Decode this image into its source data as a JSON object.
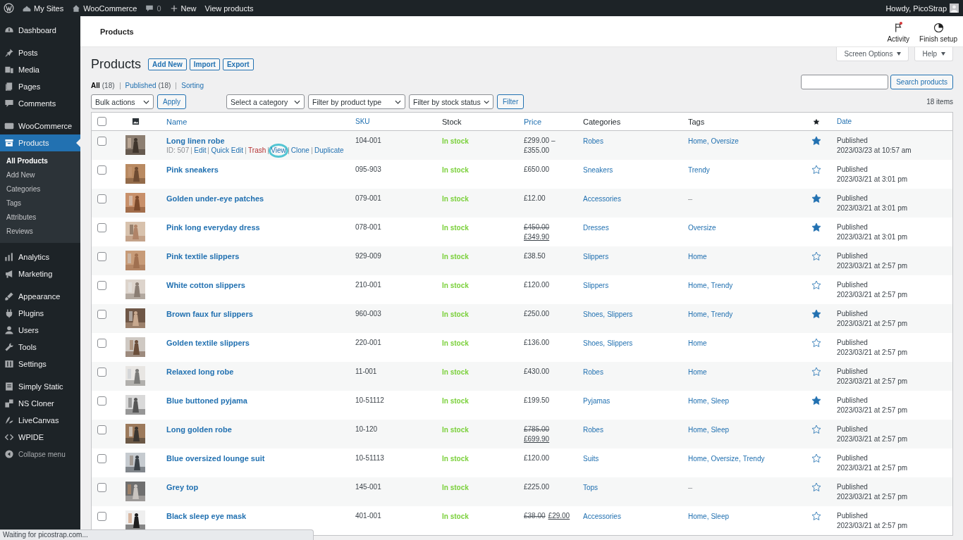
{
  "admin_bar": {
    "items": [
      {
        "label": "My Sites"
      },
      {
        "label": "WooCommerce"
      },
      {
        "label": "0"
      },
      {
        "label": "New"
      },
      {
        "label": "View products"
      }
    ],
    "account": "Howdy, PicoStrap"
  },
  "sidebar": {
    "groups": [
      [
        {
          "label": "Dashboard",
          "selected": false
        }
      ],
      [
        {
          "label": "Posts",
          "selected": false
        },
        {
          "label": "Media",
          "selected": false
        },
        {
          "label": "Pages",
          "selected": false
        },
        {
          "label": "Comments",
          "selected": false
        }
      ],
      [
        {
          "label": "WooCommerce",
          "selected": false
        },
        {
          "label": "Products",
          "selected": true,
          "children": [
            {
              "label": "All Products",
              "selected": true
            },
            {
              "label": "Add New",
              "selected": false
            },
            {
              "label": "Categories",
              "selected": false
            },
            {
              "label": "Tags",
              "selected": false
            },
            {
              "label": "Attributes",
              "selected": false
            },
            {
              "label": "Reviews",
              "selected": false
            }
          ]
        }
      ],
      [
        {
          "label": "Analytics",
          "selected": false
        },
        {
          "label": "Marketing",
          "selected": false
        }
      ],
      [
        {
          "label": "Appearance",
          "selected": false
        },
        {
          "label": "Plugins",
          "selected": false
        },
        {
          "label": "Users",
          "selected": false
        },
        {
          "label": "Tools",
          "selected": false
        },
        {
          "label": "Settings",
          "selected": false
        }
      ],
      [
        {
          "label": "Simply Static",
          "selected": false
        },
        {
          "label": "NS Cloner",
          "selected": false
        },
        {
          "label": "LiveCanvas",
          "selected": false
        },
        {
          "label": "WPIDE",
          "selected": false
        },
        {
          "label": "Collapse menu",
          "selected": false
        }
      ]
    ]
  },
  "header": {
    "title": "Products",
    "actions": [
      {
        "label": "Activity",
        "notification": true
      },
      {
        "label": "Finish setup",
        "notification": false
      }
    ]
  },
  "screen_tabs": [
    "Screen Options",
    "Help"
  ],
  "page": {
    "title": "Products",
    "buttons": [
      "Add New",
      "Import",
      "Export"
    ]
  },
  "views": [
    {
      "label": "All",
      "count": "(18)",
      "selected": true
    },
    {
      "label": "Published",
      "count": "(18)",
      "selected": false
    },
    {
      "label": "Sorting",
      "selected": false
    }
  ],
  "search": {
    "button": "Search products"
  },
  "filters": {
    "bulk": "Bulk actions",
    "apply": "Apply",
    "selects": [
      "Select a category",
      "Filter by product type",
      "Filter by stock status"
    ],
    "filter": "Filter",
    "count": "18 items"
  },
  "table": {
    "columns": [
      {
        "label": "Name",
        "sortable": true
      },
      {
        "label": "SKU",
        "sortable": true
      },
      {
        "label": "Stock",
        "sortable": false
      },
      {
        "label": "Price",
        "sortable": true
      },
      {
        "label": "Categories",
        "sortable": false
      },
      {
        "label": "Tags",
        "sortable": false
      },
      {
        "label": "Date",
        "sortable": true
      }
    ],
    "select_all": {
      "checked": false
    },
    "rows": [
      {
        "checked": false,
        "name": "Long linen robe",
        "actions": [
          {
            "label": "ID: 507",
            "kind": "id",
            "highlighted": false
          },
          {
            "label": "Edit",
            "kind": "link",
            "highlighted": false
          },
          {
            "label": "Quick Edit",
            "kind": "link",
            "highlighted": false
          },
          {
            "label": "Trash",
            "kind": "trash",
            "highlighted": false
          },
          {
            "label": "View",
            "kind": "link",
            "highlighted": true
          },
          {
            "label": "Clone",
            "kind": "link",
            "highlighted": false
          },
          {
            "label": "Duplicate",
            "kind": "link",
            "highlighted": false
          }
        ],
        "sku": "104-001",
        "stock": "In stock",
        "price": [
          [
            {
              "text": "£299.00 –",
              "kind": "plain"
            }
          ],
          [
            {
              "text": "£355.00",
              "kind": "plain"
            }
          ]
        ],
        "categories": [
          "Robes"
        ],
        "tags": [
          "Home,",
          "Oversize"
        ],
        "featured": true,
        "status": "Published",
        "date": "2023/03/23 at 10:57 am"
      },
      {
        "checked": false,
        "name": "Pink sneakers",
        "sku": "095-903",
        "stock": "In stock",
        "price": [
          [
            {
              "text": "£650.00",
              "kind": "plain"
            }
          ]
        ],
        "categories": [
          "Sneakers"
        ],
        "tags": [
          "Trendy"
        ],
        "featured": false,
        "status": "Published",
        "date": "2023/03/21 at 3:01 pm"
      },
      {
        "checked": false,
        "name": "Golden under-eye patches",
        "sku": "079-001",
        "stock": "In stock",
        "price": [
          [
            {
              "text": "£12.00",
              "kind": "plain"
            }
          ]
        ],
        "categories": [
          "Accessories"
        ],
        "tags": [],
        "no_tags": "–",
        "featured": true,
        "status": "Published",
        "date": "2023/03/21 at 3:01 pm"
      },
      {
        "checked": false,
        "name": "Pink long everyday dress",
        "sku": "078-001",
        "stock": "In stock",
        "price": [
          [
            {
              "text": "£450.00",
              "kind": "old"
            }
          ],
          [
            {
              "text": "£349.90",
              "kind": "sale"
            }
          ]
        ],
        "categories": [
          "Dresses"
        ],
        "tags": [
          "Oversize"
        ],
        "featured": true,
        "status": "Published",
        "date": "2023/03/21 at 3:01 pm"
      },
      {
        "checked": false,
        "name": "Pink textile slippers",
        "sku": "929-009",
        "stock": "In stock",
        "price": [
          [
            {
              "text": "£38.50",
              "kind": "plain"
            }
          ]
        ],
        "categories": [
          "Slippers"
        ],
        "tags": [
          "Home"
        ],
        "featured": false,
        "status": "Published",
        "date": "2023/03/21 at 2:57 pm"
      },
      {
        "checked": false,
        "name": "White cotton slippers",
        "sku": "210-001",
        "stock": "In stock",
        "price": [
          [
            {
              "text": "£120.00",
              "kind": "plain"
            }
          ]
        ],
        "categories": [
          "Slippers"
        ],
        "tags": [
          "Home,",
          "Trendy"
        ],
        "featured": false,
        "status": "Published",
        "date": "2023/03/21 at 2:57 pm"
      },
      {
        "checked": false,
        "name": "Brown faux fur slippers",
        "sku": "960-003",
        "stock": "In stock",
        "price": [
          [
            {
              "text": "£250.00",
              "kind": "plain"
            }
          ]
        ],
        "categories": [
          "Shoes,",
          "Slippers"
        ],
        "tags": [
          "Home,",
          "Trendy"
        ],
        "featured": true,
        "status": "Published",
        "date": "2023/03/21 at 2:57 pm"
      },
      {
        "checked": false,
        "name": "Golden textile slippers",
        "sku": "220-001",
        "stock": "In stock",
        "price": [
          [
            {
              "text": "£136.00",
              "kind": "plain"
            }
          ]
        ],
        "categories": [
          "Shoes,",
          "Slippers"
        ],
        "tags": [
          "Home"
        ],
        "featured": false,
        "status": "Published",
        "date": "2023/03/21 at 2:57 pm"
      },
      {
        "checked": false,
        "name": "Relaxed long robe",
        "sku": "11-001",
        "stock": "In stock",
        "price": [
          [
            {
              "text": "£430.00",
              "kind": "plain"
            }
          ]
        ],
        "categories": [
          "Robes"
        ],
        "tags": [
          "Home"
        ],
        "featured": false,
        "status": "Published",
        "date": "2023/03/21 at 2:57 pm"
      },
      {
        "checked": false,
        "name": "Blue buttoned pyjama",
        "sku": "10-51112",
        "stock": "In stock",
        "price": [
          [
            {
              "text": "£199.50",
              "kind": "plain"
            }
          ]
        ],
        "categories": [
          "Pyjamas"
        ],
        "tags": [
          "Home,",
          "Sleep"
        ],
        "featured": true,
        "status": "Published",
        "date": "2023/03/21 at 2:57 pm"
      },
      {
        "checked": false,
        "name": "Long golden robe",
        "sku": "10-120",
        "stock": "In stock",
        "price": [
          [
            {
              "text": "£785.00",
              "kind": "old"
            }
          ],
          [
            {
              "text": "£699.90",
              "kind": "sale"
            }
          ]
        ],
        "categories": [
          "Robes"
        ],
        "tags": [
          "Home,",
          "Sleep"
        ],
        "featured": false,
        "status": "Published",
        "date": "2023/03/21 at 2:57 pm"
      },
      {
        "checked": false,
        "name": "Blue oversized lounge suit",
        "sku": "10-51113",
        "stock": "In stock",
        "price": [
          [
            {
              "text": "£120.00",
              "kind": "plain"
            }
          ]
        ],
        "categories": [
          "Suits"
        ],
        "tags": [
          "Home,",
          "Oversize,",
          "Trendy"
        ],
        "featured": false,
        "status": "Published",
        "date": "2023/03/21 at 2:57 pm"
      },
      {
        "checked": false,
        "name": "Grey top",
        "sku": "145-001",
        "stock": "In stock",
        "price": [
          [
            {
              "text": "£225.00",
              "kind": "plain"
            }
          ]
        ],
        "categories": [
          "Tops"
        ],
        "tags": [],
        "no_tags": "–",
        "featured": false,
        "status": "Published",
        "date": "2023/03/21 at 2:57 pm"
      },
      {
        "checked": false,
        "name": "Black sleep eye mask",
        "sku": "401-001",
        "stock": "In stock",
        "price": [
          [
            {
              "text": "£38.00",
              "kind": "old"
            },
            {
              "text": "£29.00",
              "kind": "sale"
            }
          ]
        ],
        "categories": [
          "Accessories"
        ],
        "tags": [
          "Home,",
          "Sleep"
        ],
        "featured": false,
        "status": "Published",
        "date": "2023/03/21 at 2:57 pm"
      }
    ]
  },
  "browser_status": "Waiting for picostrap.com..."
}
